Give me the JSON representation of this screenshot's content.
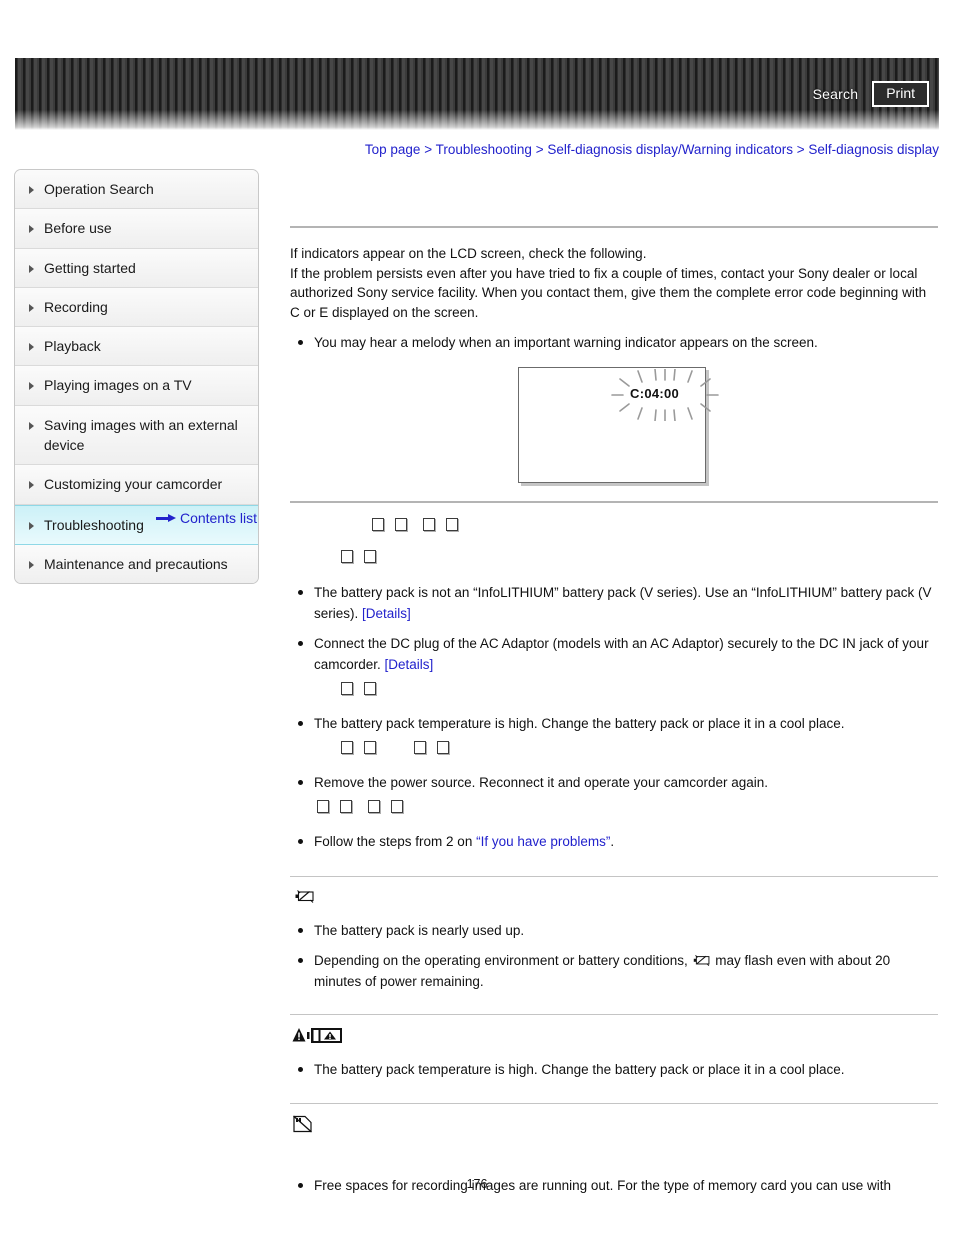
{
  "header": {
    "search_label": "Search",
    "print_label": "Print"
  },
  "breadcrumb": {
    "separator": ">",
    "items": [
      {
        "label": "Top page"
      },
      {
        "label": "Troubleshooting"
      },
      {
        "label": "Self-diagnosis display/Warning indicators"
      },
      {
        "label": "Self-diagnosis display"
      }
    ]
  },
  "sidebar": {
    "items": [
      {
        "label": "Operation Search",
        "active": false
      },
      {
        "label": "Before use",
        "active": false
      },
      {
        "label": "Getting started",
        "active": false
      },
      {
        "label": "Recording",
        "active": false
      },
      {
        "label": "Playback",
        "active": false
      },
      {
        "label": "Playing images on a TV",
        "active": false
      },
      {
        "label": "Saving images with an external device",
        "active": false
      },
      {
        "label": "Customizing your camcorder",
        "active": false
      },
      {
        "label": "Troubleshooting",
        "active": true
      },
      {
        "label": "Maintenance and precautions",
        "active": false
      }
    ],
    "contents_list_label": "Contents list"
  },
  "main": {
    "intro_line_1": "If indicators appear on the LCD screen, check the following.",
    "intro_line_2": "If the problem persists even after you have tried to fix a couple of times, contact your Sony dealer or local authorized Sony service facility. When you contact them, give them the complete error code beginning with C or E displayed on the screen.",
    "note_melody": "You may hear a melody when an important warning indicator appears on the screen.",
    "lcd": {
      "error_code": "C:04:00"
    },
    "section_c0400": {
      "bullets": [
        {
          "text_before": "The battery pack is not an “InfoLITHIUM” battery pack (V series). Use an “InfoLITHIUM” battery pack (V series). ",
          "link": "[Details]",
          "text_after": ""
        },
        {
          "text_before": "Connect the DC plug of the AC Adaptor (models with an AC Adaptor) securely to the DC IN jack of your camcorder. ",
          "link": "[Details]",
          "text_after": ""
        },
        {
          "text_before": "The battery pack temperature is high. Change the battery pack or place it in a cool place.",
          "link": "",
          "text_after": ""
        },
        {
          "text_before": "Remove the power source. Reconnect it and operate your camcorder again.",
          "link": "",
          "text_after": ""
        },
        {
          "text_before": "Follow the steps from 2 on ",
          "link": "“If you have problems”",
          "text_after": "."
        }
      ]
    },
    "section_battery_low": {
      "icon_name": "battery-low-icon",
      "bullets": [
        "The battery pack is nearly used up.",
        "Depending on the operating environment or battery conditions, |ICON| may flash even with about 20 minutes of power remaining."
      ],
      "bullet_2_before": "Depending on the operating environment or battery conditions, ",
      "bullet_2_after": " may flash even with about 20 minutes of power remaining."
    },
    "section_battery_temp": {
      "icon_name": "battery-temperature-warning-icon",
      "bullet": "The battery pack temperature is high. Change the battery pack or place it in a cool place."
    },
    "section_memory_card": {
      "icon_name": "memory-card-full-icon",
      "bullet": "Free spaces for recording images are running out. For the type of memory card you can use with"
    }
  },
  "page_number": "176",
  "colors": {
    "link": "#2222cc",
    "active_nav": "#ccf1f7",
    "header_bar": "#3a3a3a"
  }
}
